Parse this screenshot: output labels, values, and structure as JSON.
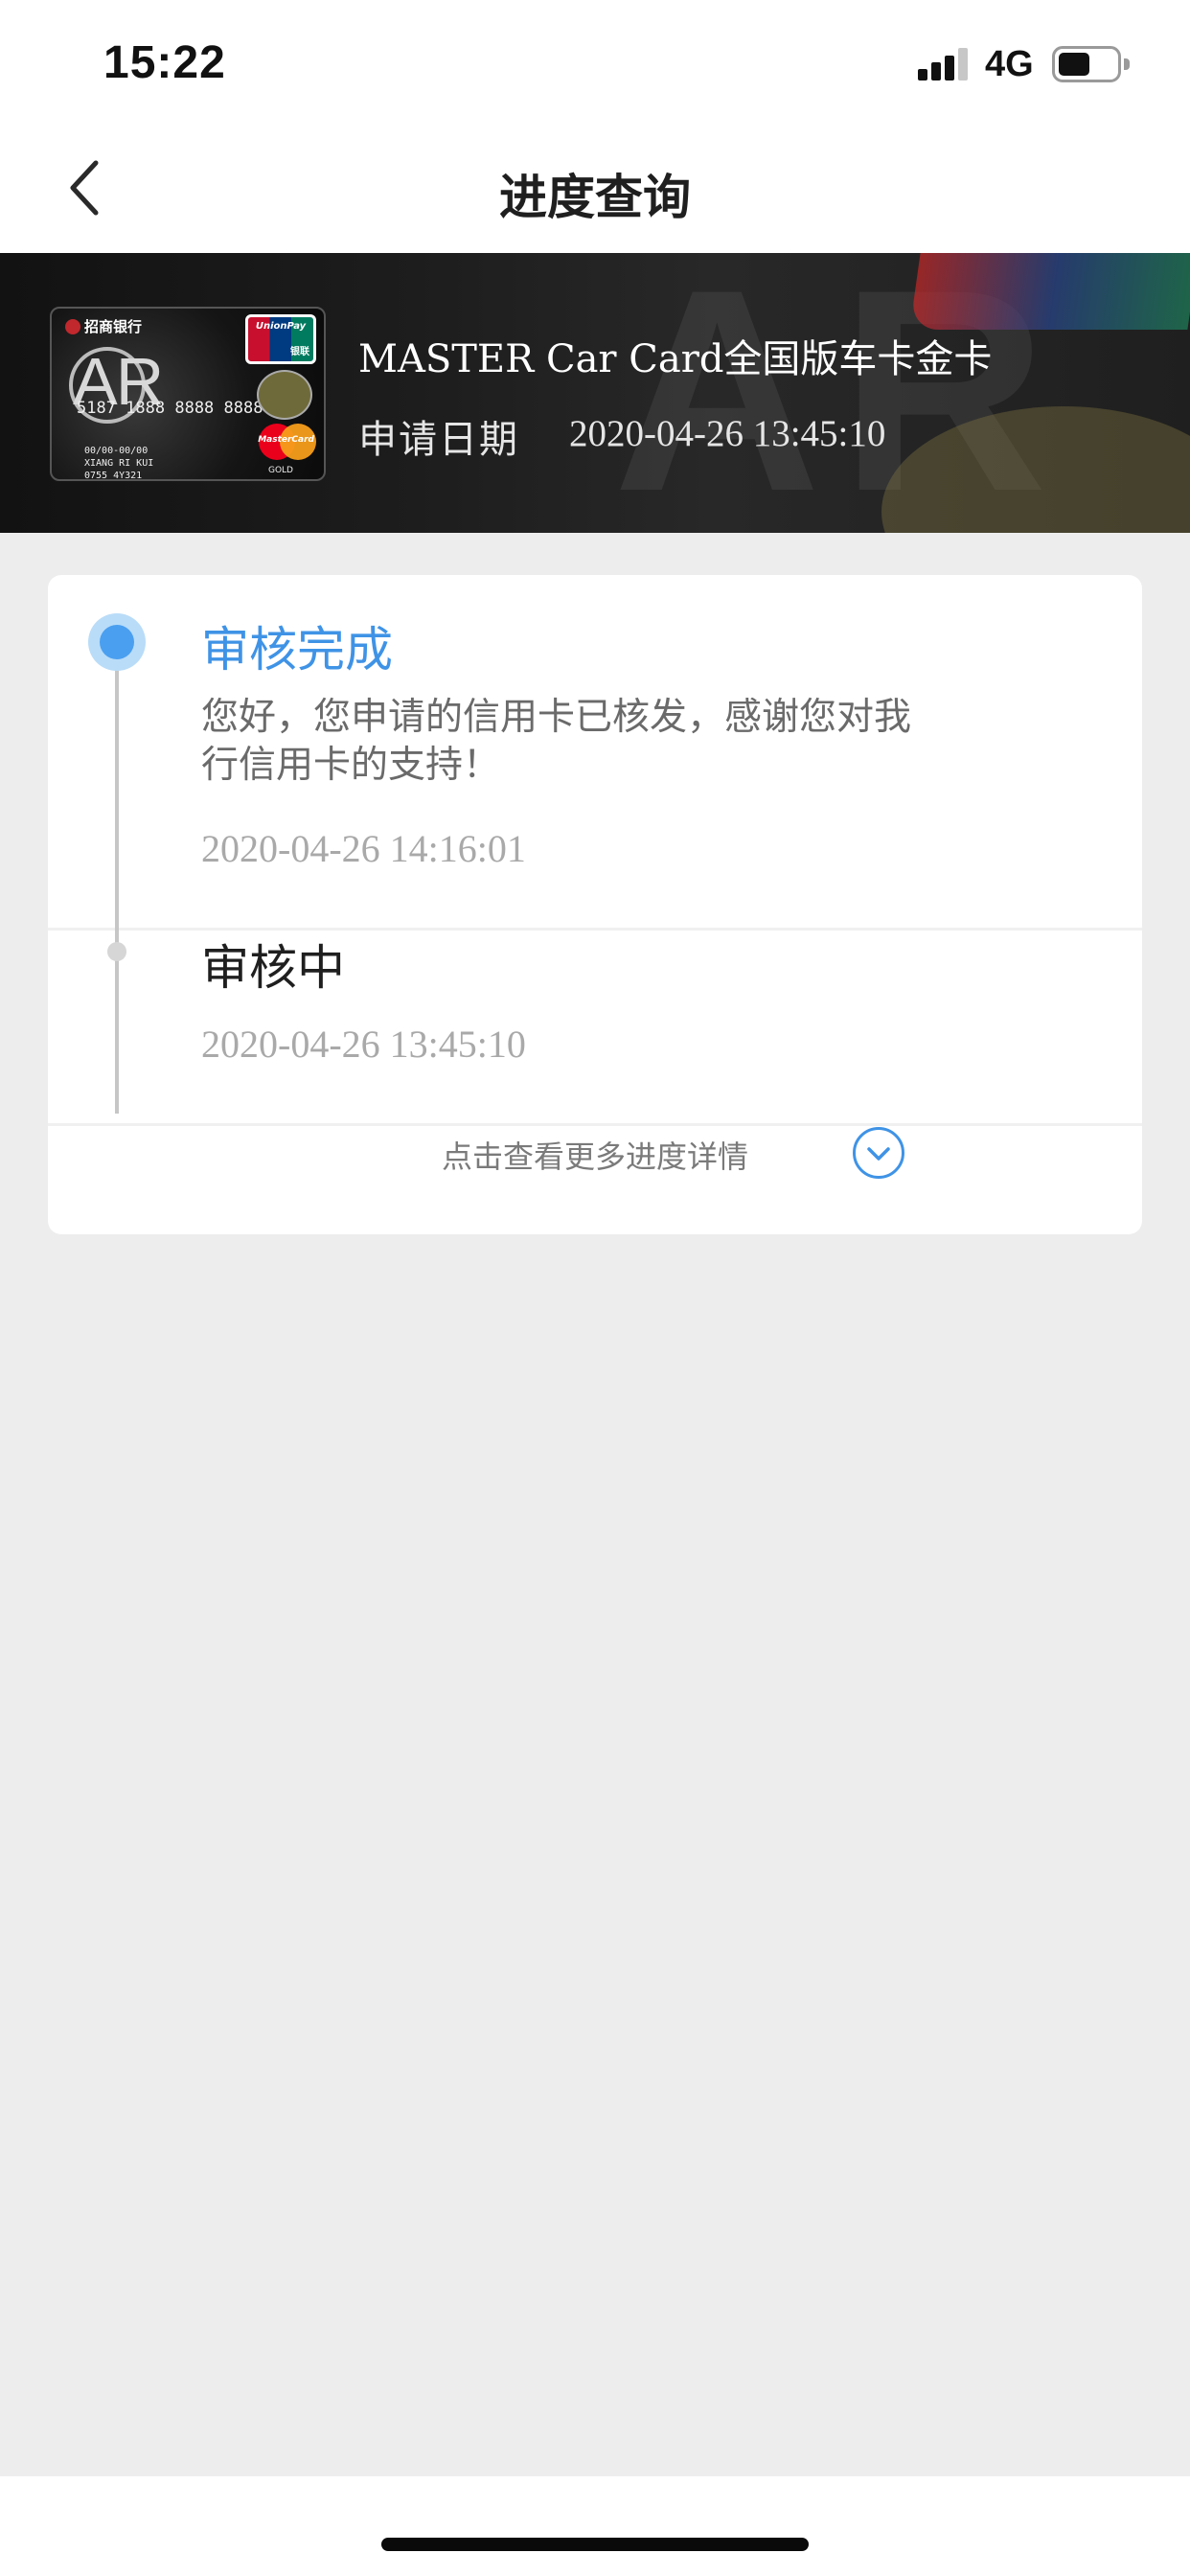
{
  "status_bar": {
    "time": "15:22",
    "network": "4G",
    "signal_bars_filled": 3,
    "signal_bars_total": 4,
    "battery_level": 0.5
  },
  "nav": {
    "title": "进度查询",
    "back_icon": "chevron-left-icon"
  },
  "banner": {
    "card_name": "MASTER Car Card全国版车卡金卡",
    "apply_date_label": "申请日期",
    "apply_date_value": "2020-04-26 13:45:10",
    "card_image": {
      "bank": "招商银行",
      "brand_text": "AR",
      "number": "5187 1888 8888 8888",
      "holder": "XIANG RI KUI",
      "expiry": "00/00-00/00",
      "code": "0755 4Y321",
      "unionpay": "UnionPay",
      "unionpay_cn": "银联",
      "mastercard": "MasterCard",
      "gold": "GOLD"
    }
  },
  "progress": {
    "steps": [
      {
        "title": "审核完成",
        "message": "您好，您申请的信用卡已核发，感谢您对我行信用卡的支持！",
        "time": "2020-04-26 14:16:01",
        "active": true
      },
      {
        "title": "审核中",
        "time": "2020-04-26 13:45:10",
        "active": false
      }
    ],
    "more_label": "点击查看更多进度详情",
    "more_icon": "chevron-down-circle-icon"
  },
  "colors": {
    "accent": "#3f93e6",
    "background": "#ededed",
    "banner_background": "#1a1a1a"
  }
}
